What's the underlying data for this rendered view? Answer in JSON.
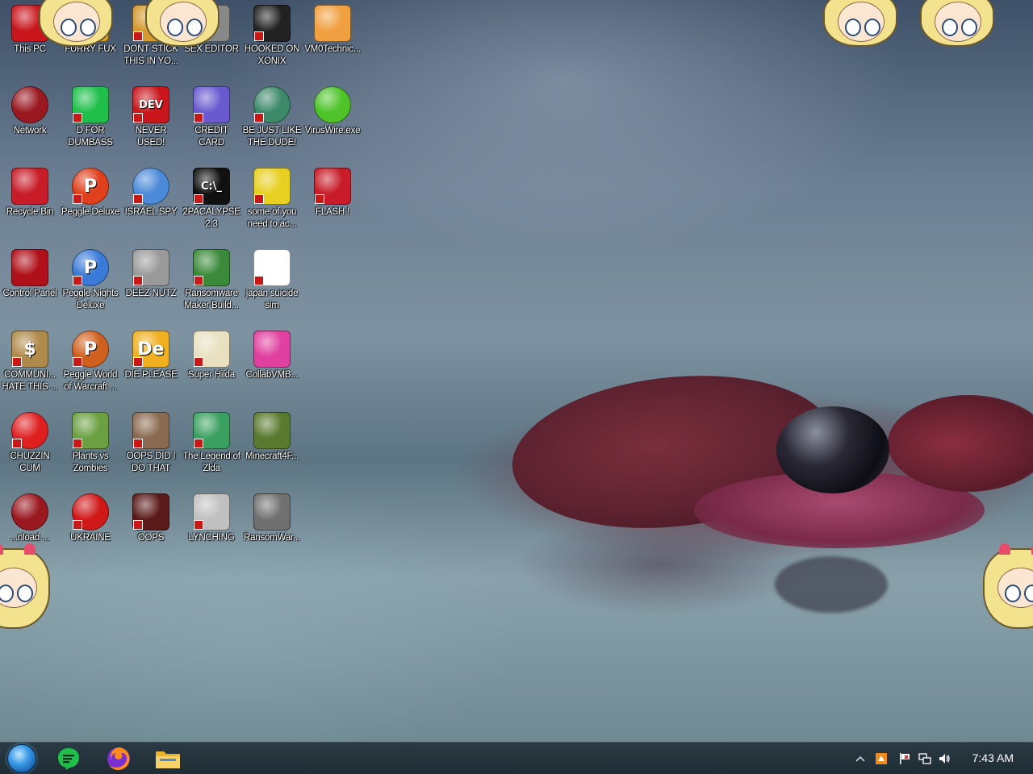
{
  "desktop": {
    "icons": [
      {
        "label": "This PC",
        "icon": "computer-icon",
        "color": "#c9161c"
      },
      {
        "label": "FURRY FUX",
        "icon": "app-icon",
        "color": "#e0a020",
        "shortcut": true
      },
      {
        "label": "DONT STICK THIS IN YO...",
        "icon": "app-icon",
        "color": "#d49a30",
        "shortcut": true
      },
      {
        "label": "SEX EDITOR",
        "icon": "app-icon",
        "color": "#888888",
        "shortcut": true
      },
      {
        "label": "HOOKED ON XONIX",
        "icon": "maze-icon",
        "color": "#222222",
        "shortcut": true
      },
      {
        "label": "VM0Technic...",
        "icon": "doctor-icon",
        "color": "#f0a040"
      },
      {
        "label": "Network",
        "icon": "network-icon",
        "color": "#9a1820"
      },
      {
        "label": "D FOR DUMBASS",
        "icon": "chat-icon",
        "color": "#1fbf4a",
        "shortcut": true
      },
      {
        "label": "NEVER USED!",
        "icon": "devcpp-icon",
        "color": "#c8161c",
        "glyph": "DEV",
        "shortcut": true
      },
      {
        "label": "CREDIT CARD CHECKER",
        "icon": "card-icon",
        "color": "#6a5ad0",
        "shortcut": true
      },
      {
        "label": "BE JUST LIKE THE DUDE!",
        "icon": "ball-icon",
        "color": "#3c8a6a",
        "shortcut": true
      },
      {
        "label": "VirusWire.exe",
        "icon": "lime-icon",
        "color": "#4ec42a"
      },
      {
        "label": "Recycle Bin",
        "icon": "recycle-bin-icon",
        "color": "#c81c28"
      },
      {
        "label": "Peggle Deluxe",
        "icon": "peggle-icon",
        "color": "#e0401c",
        "glyph": "P",
        "shortcut": true
      },
      {
        "label": "ISRAEL SPY",
        "icon": "network-share-icon",
        "color": "#4a8ad8",
        "shortcut": true
      },
      {
        "label": "2PACALYPSE 2.3",
        "icon": "terminal-icon",
        "color": "#111111",
        "glyph": "C:\\_",
        "shortcut": true
      },
      {
        "label": "some of you need to ac...",
        "icon": "beaver-icon",
        "color": "#e8d020",
        "shortcut": true
      },
      {
        "label": "FLASH !",
        "icon": "flash-icon",
        "color": "#c81c28",
        "shortcut": true
      },
      {
        "label": "Control Panel",
        "icon": "control-panel-icon",
        "color": "#b0101a"
      },
      {
        "label": "Peggle Nights Deluxe",
        "icon": "peggle-icon",
        "color": "#3a7ad8",
        "glyph": "P",
        "shortcut": true
      },
      {
        "label": "DEEZ NUTZ",
        "icon": "windows-stack-icon",
        "color": "#9a9a9a",
        "shortcut": true
      },
      {
        "label": "Ransomware Maker Build...",
        "icon": "window-app-icon",
        "color": "#3a8a3a",
        "shortcut": true
      },
      {
        "label": "japan suicide sim",
        "icon": "document-icon",
        "color": "#ffffff",
        "shortcut": true
      },
      {
        "label": "COMMUNI... HATE THIS ...",
        "icon": "money-bag-icon",
        "color": "#b08a4a",
        "glyph": "$",
        "shortcut": true
      },
      {
        "label": "Peggle World of Warcraft ...",
        "icon": "peggle-icon",
        "color": "#d06020",
        "glyph": "P",
        "shortcut": true
      },
      {
        "label": "DIE PLEASE",
        "icon": "editor-icon",
        "color": "#f0b020",
        "glyph": "De",
        "shortcut": true
      },
      {
        "label": "Super Hilda",
        "icon": "pixel-cat-icon",
        "color": "#e8e0c0",
        "shortcut": true
      },
      {
        "label": "CollabVMB...",
        "icon": "monitor-icon",
        "color": "#e040a0"
      },
      {
        "label": "CHUZZIN CUM",
        "icon": "chuzzle-icon",
        "color": "#e02020",
        "shortcut": true
      },
      {
        "label": "Plants vs Zombies",
        "icon": "flower-icon",
        "color": "#6aa040",
        "shortcut": true
      },
      {
        "label": "OOPS DID I DO THAT",
        "icon": "portrait-icon",
        "color": "#8a6a50",
        "shortcut": true
      },
      {
        "label": "The Legend of Zlda",
        "icon": "pixel-hero-icon",
        "color": "#3aa060",
        "shortcut": true
      },
      {
        "label": "Minecraft4F...",
        "icon": "grass-block-icon",
        "color": "#5a7a30"
      },
      {
        "label": "...nload ...",
        "icon": "network-icon",
        "color": "#9a1820"
      },
      {
        "label": "UKRAINE",
        "icon": "radiation-icon",
        "color": "#d01818",
        "shortcut": true
      },
      {
        "label": "OOPS",
        "icon": "scissors-icon",
        "color": "#5a1a1a",
        "shortcut": true
      },
      {
        "label": "LYNCHING",
        "icon": "zip-icon",
        "color": "#c0c0c0",
        "shortcut": true
      },
      {
        "label": "RansomWar...",
        "icon": "skull-icon",
        "color": "#707070"
      }
    ]
  },
  "taskbar": {
    "start": {
      "icon": "start-orb-icon"
    },
    "pinned": [
      {
        "name": "chat-app",
        "icon": "chat-icon",
        "color": "#1fbf4a"
      },
      {
        "name": "firefox",
        "icon": "firefox-icon",
        "color": "#ff7a1a"
      },
      {
        "name": "file-explorer",
        "icon": "folder-icon",
        "color": "#f0c040"
      }
    ],
    "tray": {
      "icons": [
        "chevron-up-icon",
        "app-tray-icon",
        "action-center-flag-icon",
        "network-tray-icon",
        "volume-icon"
      ],
      "clock": "7:43 AM"
    }
  }
}
